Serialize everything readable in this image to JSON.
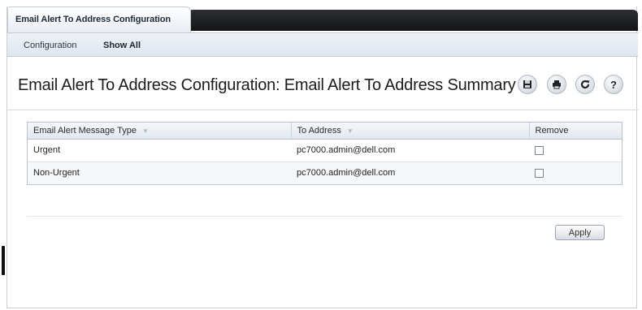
{
  "tabs": {
    "active_label": "Email Alert To Address Configuration"
  },
  "subnav": {
    "items": [
      {
        "label": "Configuration"
      },
      {
        "label": "Show All"
      }
    ]
  },
  "page": {
    "title": "Email Alert To Address Configuration: Email Alert To Address Summary"
  },
  "toolbar": {
    "icons": [
      "save-icon",
      "print-icon",
      "refresh-icon",
      "help-icon"
    ]
  },
  "table": {
    "headers": {
      "type": "Email Alert Message Type",
      "address": "To Address",
      "remove": "Remove"
    },
    "rows": [
      {
        "type": "Urgent",
        "address": "pc7000.admin@dell.com",
        "remove_checked": false
      },
      {
        "type": "Non-Urgent",
        "address": "pc7000.admin@dell.com",
        "remove_checked": false
      }
    ]
  },
  "actions": {
    "apply_label": "Apply"
  }
}
